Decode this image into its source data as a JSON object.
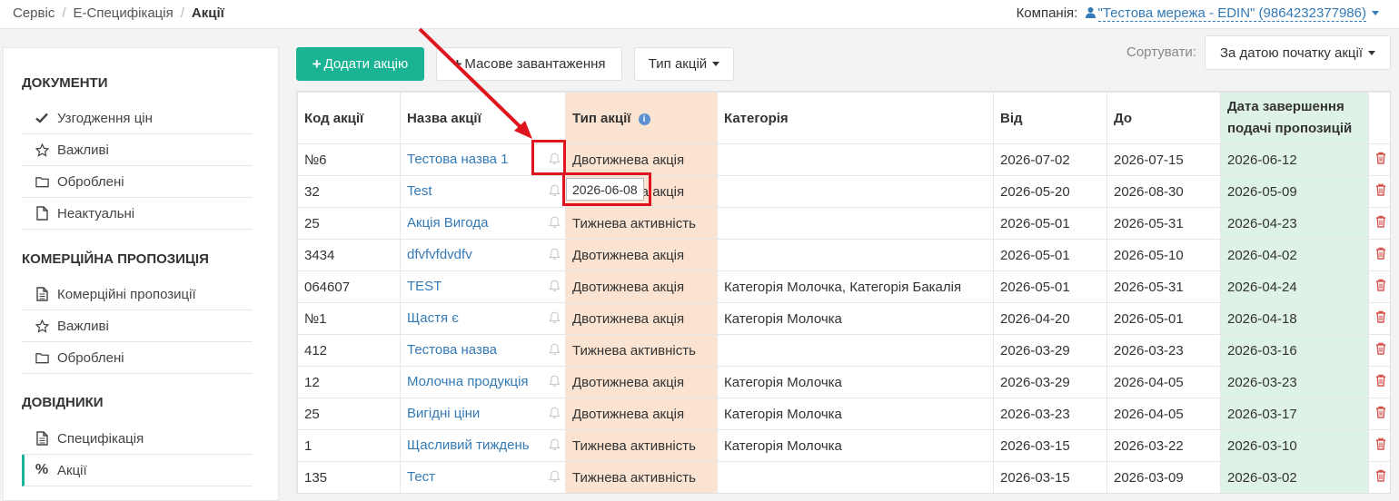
{
  "breadcrumb": [
    "Сервіс",
    "Е-Специфікація",
    "Акції"
  ],
  "company": {
    "label": "Компанія:",
    "name": "\"Тестова мережа - EDIN\" (9864232377986)"
  },
  "sidebar": {
    "sections": [
      {
        "title": "ДОКУМЕНТИ",
        "items": [
          {
            "label": "Узгодження цін",
            "icon": "check-icon"
          },
          {
            "label": "Важливі",
            "icon": "star-icon"
          },
          {
            "label": "Оброблені",
            "icon": "folder-icon"
          },
          {
            "label": "Неактуальні",
            "icon": "file-icon"
          }
        ]
      },
      {
        "title": "КОМЕРЦІЙНА ПРОПОЗИЦІЯ",
        "items": [
          {
            "label": "Комерційні пропозиції",
            "icon": "file-text-icon"
          },
          {
            "label": "Важливі",
            "icon": "star-icon"
          },
          {
            "label": "Оброблені",
            "icon": "folder-icon"
          }
        ]
      },
      {
        "title": "ДОВІДНИКИ",
        "items": [
          {
            "label": "Специфікація",
            "icon": "file-text-icon"
          },
          {
            "label": "Акції",
            "icon": "percent-icon",
            "active": true
          }
        ]
      }
    ]
  },
  "toolbar": {
    "add_label": "Додати акцію",
    "bulk_label": "Масове завантаження",
    "type_label": "Тип акцій",
    "sort_label": "Сортувати:",
    "sort_value": "За датою початку акції"
  },
  "table": {
    "headers": [
      "Код акції",
      "Назва акції",
      "Тип акції",
      "Категорія",
      "Від",
      "До",
      "Дата завершення подачі пропозицій"
    ],
    "rows": [
      [
        "№6",
        "Тестова назва 1",
        "Двотижнева акція",
        "",
        "2026-07-02",
        "2026-07-15",
        "2026-06-12"
      ],
      [
        "32",
        "Test",
        "Двотижнева акція",
        "",
        "2026-05-20",
        "2026-08-30",
        "2026-05-09"
      ],
      [
        "25",
        "Акція Вигода",
        "Тижнева активність",
        "",
        "2026-05-01",
        "2026-05-31",
        "2026-04-23"
      ],
      [
        "3434",
        "dfvfvfdvdfv",
        "Двотижнева акція",
        "",
        "2026-05-01",
        "2026-05-10",
        "2026-04-02"
      ],
      [
        "064607",
        "TEST",
        "Двотижнева акція",
        "Категорія Молочка, Категорія Бакалія",
        "2026-05-01",
        "2026-05-31",
        "2026-04-24"
      ],
      [
        "№1",
        "Щастя є",
        "Двотижнева акція",
        "Категорія Молочка",
        "2026-04-20",
        "2026-05-01",
        "2026-04-18"
      ],
      [
        "412",
        "Тестова назва",
        "Тижнева активність",
        "",
        "2026-03-29",
        "2026-03-23",
        "2026-03-16"
      ],
      [
        "12",
        "Молочна продукція",
        "Двотижнева акція",
        "Категорія Молочка",
        "2026-03-29",
        "2026-04-05",
        "2026-03-23"
      ],
      [
        "25",
        "Вигідні ціни",
        "Двотижнева акція",
        "Категорія Молочка",
        "2026-03-23",
        "2026-04-05",
        "2026-03-17"
      ],
      [
        "1",
        "Щасливий тиждень",
        "Тижнева активність",
        "Категорія Молочка",
        "2026-03-15",
        "2026-03-22",
        "2026-03-10"
      ],
      [
        "135",
        "Тест",
        "Тижнева активність",
        "",
        "2026-03-15",
        "2026-03-09",
        "2026-03-02"
      ]
    ]
  },
  "tooltip": {
    "text": "2026-06-08"
  },
  "colors": {
    "accent": "#1ab394",
    "link": "#337ab7",
    "type_col": "#fbe3d1",
    "end_col": "#dff2e7",
    "annotation": "#e0141e",
    "trash": "#d9534f"
  }
}
